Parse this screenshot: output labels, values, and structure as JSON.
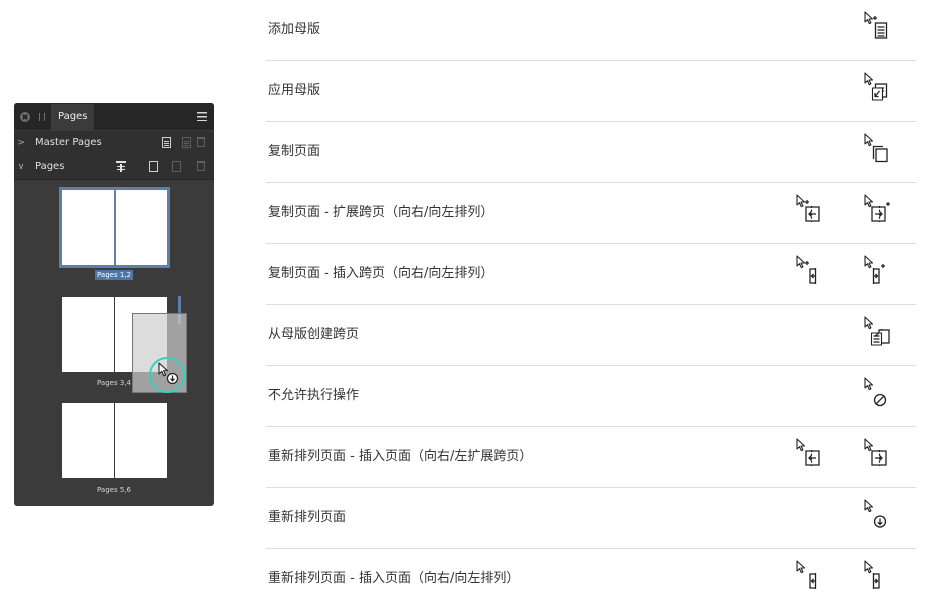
{
  "panel": {
    "tab_title": "Pages",
    "master_pages_label": "Master Pages",
    "pages_label": "Pages",
    "chevron_collapsed": ">",
    "chevron_expanded": "∨",
    "spreads": [
      {
        "label": "Pages 1,2",
        "selected": true
      },
      {
        "label": "Pages 3,4",
        "selected": false
      },
      {
        "label": "Pages 5,6",
        "selected": false
      }
    ],
    "accent_color": "#5f7ea8",
    "drag_indicator_color": "#33d0c0"
  },
  "reference": {
    "rows": [
      {
        "label": "添加母版",
        "icons": [
          "cursor-add-master-icon"
        ]
      },
      {
        "label": "应用母版",
        "icons": [
          "cursor-apply-master-icon"
        ]
      },
      {
        "label": "复制页面",
        "icons": [
          "cursor-copy-page-icon"
        ]
      },
      {
        "label": "复制页面 - 扩展跨页（向右/向左排列）",
        "icons": [
          "cursor-copy-extend-spread-left-icon",
          "cursor-copy-extend-spread-right-icon"
        ]
      },
      {
        "label": "复制页面 - 插入跨页（向右/向左排列）",
        "icons": [
          "cursor-copy-insert-spread-left-icon",
          "cursor-copy-insert-spread-right-icon"
        ]
      },
      {
        "label": "从母版创建跨页",
        "icons": [
          "cursor-create-spread-from-master-icon"
        ]
      },
      {
        "label": "不允许执行操作",
        "icons": [
          "cursor-not-allowed-icon"
        ]
      },
      {
        "label": "重新排列页面 - 插入页面（向右/左扩展跨页）",
        "icons": [
          "cursor-reorder-extend-spread-left-icon",
          "cursor-reorder-extend-spread-right-icon"
        ]
      },
      {
        "label": "重新排列页面",
        "icons": [
          "cursor-reorder-icon"
        ]
      },
      {
        "label": "重新排列页面 - 插入页面（向右/向左排列）",
        "icons": [
          "cursor-reorder-insert-left-icon",
          "cursor-reorder-insert-right-icon"
        ]
      }
    ]
  }
}
